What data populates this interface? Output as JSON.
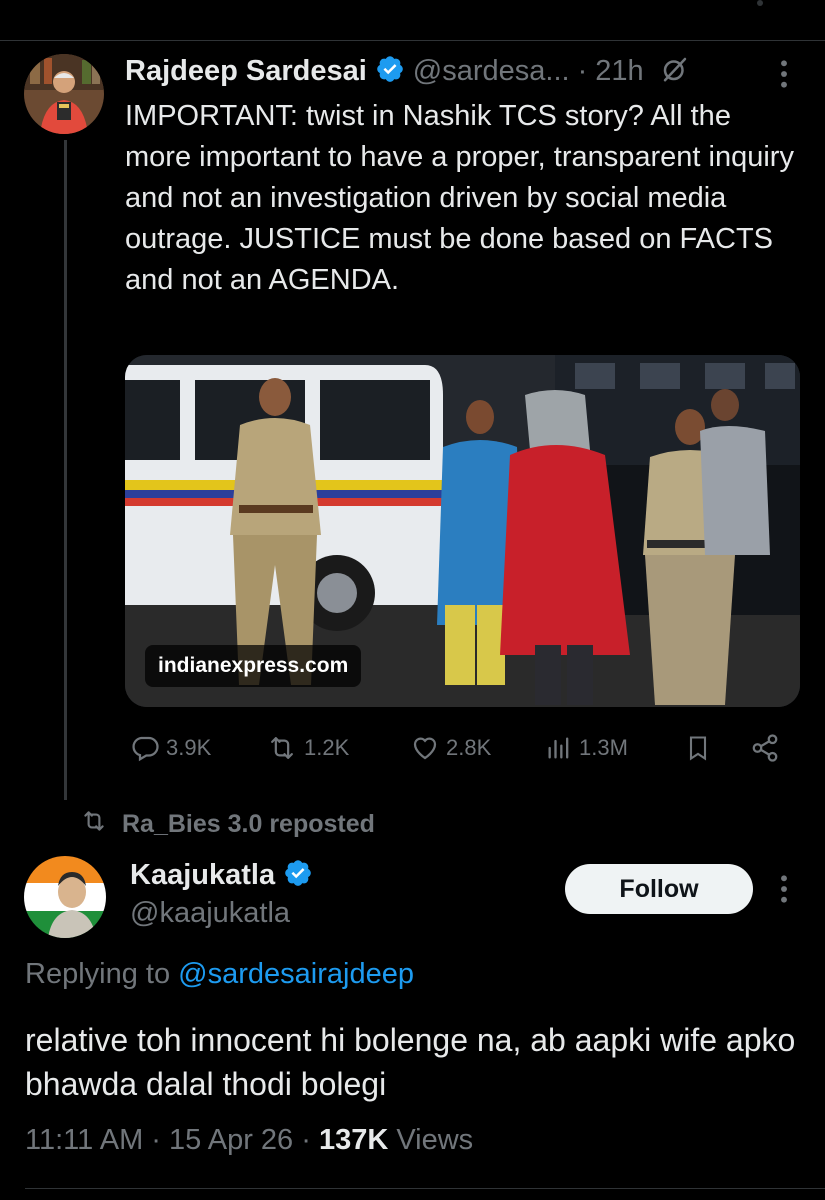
{
  "original_tweet": {
    "author_name": "Rajdeep Sardesai",
    "author_handle": "@sardesa...",
    "time": "· 21h",
    "text": "IMPORTANT: twist in Nashik TCS story? All the more important to have a proper, transparent inquiry and not an investigation driven by social media outrage. JUSTICE must be done based on FACTS and not an AGENDA.",
    "media_source": "indianexpress.com",
    "stats": {
      "replies": "3.9K",
      "reposts": "1.2K",
      "likes": "2.8K",
      "views": "1.3M"
    }
  },
  "repost_banner": {
    "text": "Ra_Bies 3.0 reposted"
  },
  "reply_tweet": {
    "author_name": "Kaajukatla",
    "author_handle": "@kaajukatla",
    "follow_label": "Follow",
    "replying_prefix": "Replying to",
    "replying_to": "@sardesairajdeep",
    "text": "relative toh innocent hi bolenge na, ab aapki wife apko bhawda dalal thodi bolegi",
    "time": "11:11 AM",
    "date": "15 Apr 26",
    "views_count": "137K",
    "views_label": "Views"
  },
  "colors": {
    "background": "#000000",
    "text_primary": "#e7e9ea",
    "text_secondary": "#71767b",
    "accent_blue": "#1d9bf0",
    "follow_bg": "#eff3f4"
  },
  "icons": [
    "verified-badge-icon",
    "grok-icon",
    "more-icon",
    "reply-icon",
    "repost-icon",
    "like-icon",
    "views-icon",
    "bookmark-icon",
    "share-icon"
  ]
}
